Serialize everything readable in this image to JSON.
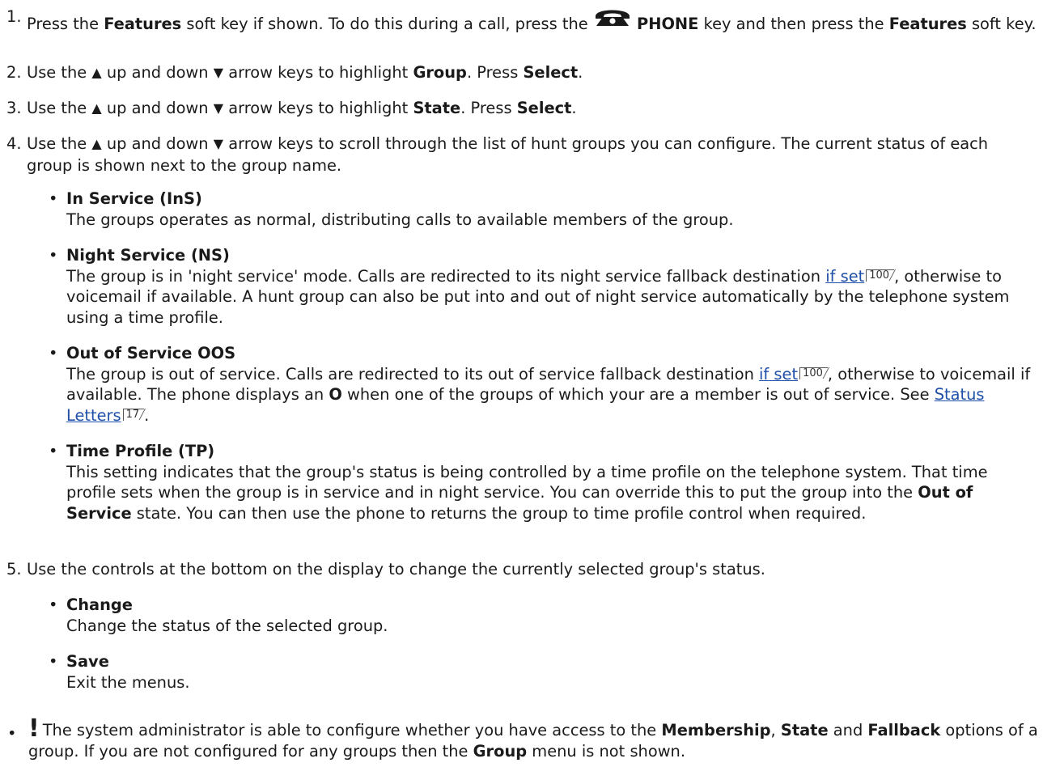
{
  "steps": [
    {
      "number": "1.",
      "segments": [
        {
          "t": "Press the "
        },
        {
          "t": "Features",
          "b": true
        },
        {
          "t": " soft key if shown. To do this during a call, press the "
        },
        {
          "icon": "phone-icon"
        },
        {
          "t": " "
        },
        {
          "t": "PHONE",
          "b": true
        },
        {
          "t": " key and then press the "
        },
        {
          "t": "Features",
          "b": true
        },
        {
          "t": " soft key."
        }
      ]
    },
    {
      "number": "2.",
      "segments": [
        {
          "t": "Use the "
        },
        {
          "icon": "up-arrow-icon"
        },
        {
          "t": " up and down "
        },
        {
          "icon": "down-arrow-icon"
        },
        {
          "t": " arrow keys to highlight "
        },
        {
          "t": "Group",
          "b": true
        },
        {
          "t": ". Press "
        },
        {
          "t": "Select",
          "b": true
        },
        {
          "t": "."
        }
      ]
    },
    {
      "number": "3.",
      "segments": [
        {
          "t": "Use the "
        },
        {
          "icon": "up-arrow-icon"
        },
        {
          "t": " up and down "
        },
        {
          "icon": "down-arrow-icon"
        },
        {
          "t": " arrow keys to highlight "
        },
        {
          "t": "State",
          "b": true
        },
        {
          "t": ". Press "
        },
        {
          "t": "Select",
          "b": true
        },
        {
          "t": "."
        }
      ]
    },
    {
      "number": "4.",
      "segments": [
        {
          "t": "Use the "
        },
        {
          "icon": "up-arrow-icon"
        },
        {
          "t": " up and down "
        },
        {
          "icon": "down-arrow-icon"
        },
        {
          "t": " arrow keys to scroll through the list of hunt groups you can configure. The current status of each group is shown next to the group name."
        }
      ],
      "bullets": [
        {
          "title": "In Service (InS)",
          "segments": [
            {
              "t": "The groups operates as normal, distributing calls to available members of the group."
            }
          ]
        },
        {
          "title": "Night Service (NS)",
          "segments": [
            {
              "t": "The group is in 'night service' mode. Calls are redirected to its night service fallback destination "
            },
            {
              "link": "if set",
              "ref": "100"
            },
            {
              "t": ", otherwise to voicemail if available. A hunt group can also be put into and out of night service automatically by the telephone system using a time profile."
            }
          ]
        },
        {
          "title": "Out of Service OOS",
          "segments": [
            {
              "t": "The group is out of service. Calls are redirected to its out of service fallback destination "
            },
            {
              "link": "if set",
              "ref": "100"
            },
            {
              "t": ", otherwise to voicemail if available. The phone displays an "
            },
            {
              "t": "O",
              "b": true
            },
            {
              "t": " when one of the groups of which your are a member is out of service. See "
            },
            {
              "link": "Status Letters",
              "ref": "17"
            },
            {
              "t": "."
            }
          ]
        },
        {
          "title": "Time Profile (TP)",
          "segments": [
            {
              "t": "This setting indicates that the group's status is being controlled by a time profile on the telephone system. That time profile sets when the group is in service and in night service. You can override this to put the group into the "
            },
            {
              "t": "Out of Service",
              "b": true
            },
            {
              "t": " state. You can then use the phone to returns the group to time profile control when required."
            }
          ]
        }
      ]
    },
    {
      "number": "5.",
      "segments": [
        {
          "t": "Use the controls at the bottom on the display to change the currently selected group's status."
        }
      ],
      "bullets": [
        {
          "title": "Change",
          "segments": [
            {
              "t": "Change the status of the selected group."
            }
          ]
        },
        {
          "title": "Save",
          "segments": [
            {
              "t": "Exit the menus."
            }
          ]
        }
      ]
    }
  ],
  "note": {
    "mark": "!",
    "segments": [
      {
        "t": "The system administrator is able to configure whether you have access to the "
      },
      {
        "t": "Membership",
        "b": true
      },
      {
        "t": ", "
      },
      {
        "t": "State",
        "b": true
      },
      {
        "t": " and "
      },
      {
        "t": "Fallback",
        "b": true
      },
      {
        "t": " options of a group. If you are not configured for any groups then the "
      },
      {
        "t": "Group",
        "b": true
      },
      {
        "t": " menu is not shown."
      }
    ]
  }
}
